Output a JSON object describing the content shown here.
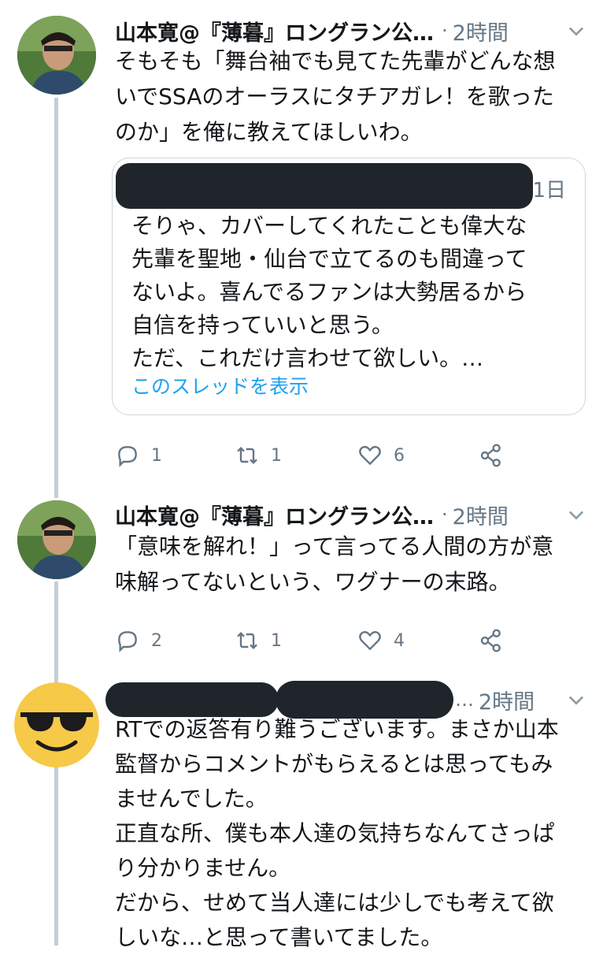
{
  "tweets": [
    {
      "author": "山本寛@『薄暮』ロングラン公…",
      "dot": "·",
      "time": "2時間",
      "text": "そもそも「舞台袖でも見てた先輩がどんな想\nいでSSAのオーラスにタチアガレ！を歌った\nのか」を俺に教えてほしいわ。",
      "quote": {
        "time": "1日",
        "text": "そりゃ、カバーしてくれたことも偉大な\n先輩を聖地・仙台で立てるのも間違って\nないよ。喜んでるファンは大勢居るから\n自信を持っていいと思う。\nただ、これだけ言わせて欲しい。…",
        "link": "このスレッドを表示"
      },
      "replies": "1",
      "retweets": "1",
      "likes": "6"
    },
    {
      "author": "山本寛@『薄暮』ロングラン公…",
      "dot": "·",
      "time": "2時間",
      "text": "「意味を解れ！」って言ってる人間の方が意\n味解ってないという、ワグナーの末路。",
      "replies": "2",
      "retweets": "1",
      "likes": "4"
    },
    {
      "dot": "…",
      "time": "2時間",
      "text": "RTでの返答有り難うございます。まさか山本\n監督からコメントがもらえるとは思ってもみ\nませんでした。\n正直な所、僕も本人達の気持ちなんてさっぱ\nり分かりません。\nだから、せめて当人達には少しでも考えて欲\nしいな…と思って書いてました。"
    }
  ],
  "colors": {
    "muted": "#657786",
    "link": "#1da1f2",
    "thread": "#c4cfd6",
    "emoji": "#f7c948"
  },
  "icons": [
    "reply-icon",
    "retweet-icon",
    "like-icon",
    "share-icon",
    "chevron-down-icon",
    "sunglasses-emoji-avatar"
  ]
}
